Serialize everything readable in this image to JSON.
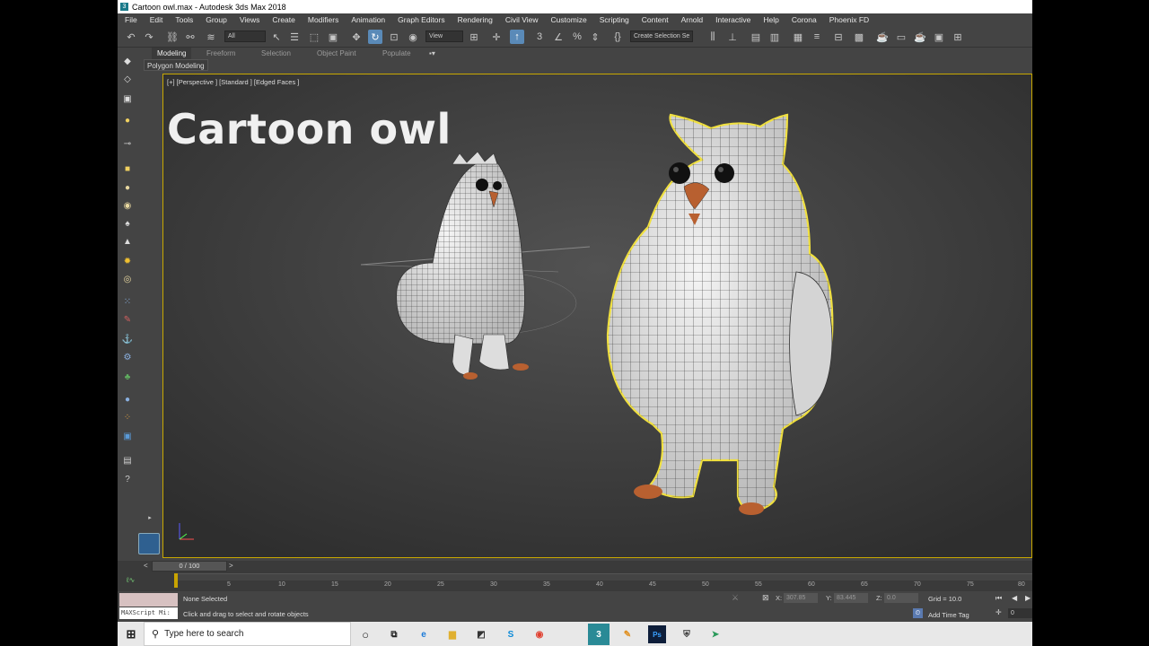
{
  "window": {
    "title": "Cartoon owl.max - Autodesk 3ds Max 2018",
    "app_icon": "3"
  },
  "menu": [
    "File",
    "Edit",
    "Tools",
    "Group",
    "Views",
    "Create",
    "Modifiers",
    "Animation",
    "Graph Editors",
    "Rendering",
    "Civil View",
    "Customize",
    "Scripting",
    "Content",
    "Arnold",
    "Interactive",
    "Help",
    "Corona",
    "Phoenix FD"
  ],
  "toolbar": {
    "filter_value": "All",
    "reference_value": "View",
    "selection_set_placeholder": "Create Selection Se"
  },
  "ribbon": {
    "tabs": [
      "Modeling",
      "Freeform",
      "Selection",
      "Object Paint",
      "Populate"
    ],
    "active_tab": "Modeling",
    "sub_label": "Polygon Modeling"
  },
  "viewport": {
    "label": "[+] [Perspective ] [Standard ] [Edged Faces ]",
    "title_text": "Cartoon owl"
  },
  "timeline": {
    "frame_display": "0 / 100",
    "ticks": [
      "5",
      "10",
      "15",
      "20",
      "25",
      "30",
      "35",
      "40",
      "45",
      "50",
      "55",
      "60",
      "65",
      "70",
      "75",
      "80"
    ]
  },
  "status": {
    "selection": "None Selected",
    "prompt": "Click and drag to select and rotate objects",
    "maxscript": "MAXScript Mi:",
    "x_label": "X:",
    "x_value": "307.85",
    "y_label": "Y:",
    "y_value": "83.445",
    "z_label": "Z:",
    "z_value": "0.0",
    "grid": "Grid = 10.0",
    "add_time_tag": "Add Time Tag",
    "frame_value": "0"
  },
  "taskbar": {
    "search_placeholder": "Type here to search"
  },
  "colors": {
    "viewport_border": "#c8a800",
    "active_button": "#5a8ab8",
    "owl_highlight": "#f0e040"
  }
}
